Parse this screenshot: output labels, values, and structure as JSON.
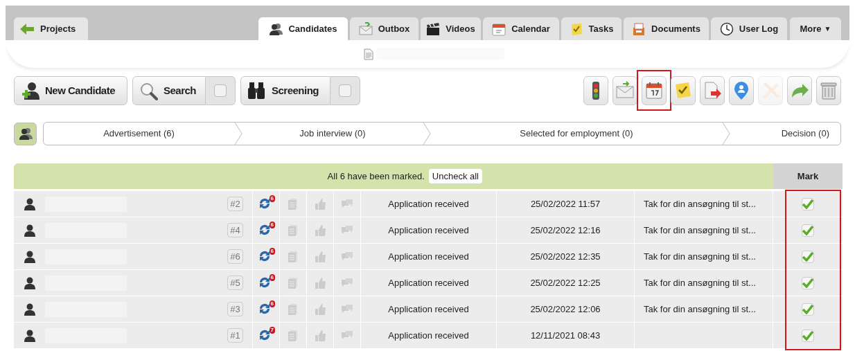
{
  "nav": {
    "back": "Projects",
    "tabs": [
      {
        "label": "Candidates",
        "selected": true
      },
      {
        "label": "Outbox",
        "selected": false
      },
      {
        "label": "Videos",
        "selected": false
      },
      {
        "label": "Calendar",
        "selected": false
      },
      {
        "label": "Tasks",
        "selected": false
      },
      {
        "label": "Documents",
        "selected": false
      },
      {
        "label": "User Log",
        "selected": false
      }
    ],
    "more": "More",
    "more_caret": "▼"
  },
  "toolbar": {
    "buttons": [
      {
        "kind": "plain",
        "label": "New Candidate"
      },
      {
        "kind": "toggle",
        "label": "Search",
        "checked": false
      },
      {
        "kind": "toggle",
        "label": "Screening",
        "checked": false
      }
    ],
    "actions": [
      {
        "highlighted": false,
        "disabled": false
      },
      {
        "highlighted": false,
        "disabled": false
      },
      {
        "highlighted": true,
        "disabled": false
      },
      {
        "highlighted": false,
        "disabled": false
      },
      {
        "highlighted": false,
        "disabled": false
      },
      {
        "highlighted": false,
        "disabled": false
      },
      {
        "highlighted": false,
        "disabled": true
      },
      {
        "highlighted": false,
        "disabled": false
      },
      {
        "highlighted": false,
        "disabled": false
      }
    ]
  },
  "pipeline": {
    "stages": [
      "Advertisement (6)",
      "Job interview (0)",
      "Selected for employment (0)",
      "Decision (0)"
    ]
  },
  "table": {
    "banner": "All 6 have been marked.",
    "uncheck_all": "Uncheck all",
    "mark_header": "Mark",
    "mark_highlighted": true,
    "rows": [
      {
        "number": "#2",
        "badge": "6",
        "status": "Application received",
        "date": "25/02/2022 11:57",
        "message": "Tak for din ansøgning til st...",
        "checked": true
      },
      {
        "number": "#4",
        "badge": "6",
        "status": "Application received",
        "date": "25/02/2022 12:16",
        "message": "Tak for din ansøgning til st...",
        "checked": true
      },
      {
        "number": "#6",
        "badge": "6",
        "status": "Application received",
        "date": "25/02/2022 12:35",
        "message": "Tak for din ansøgning til st...",
        "checked": true
      },
      {
        "number": "#5",
        "badge": "6",
        "status": "Application received",
        "date": "25/02/2022 12:25",
        "message": "Tak for din ansøgning til st...",
        "checked": true
      },
      {
        "number": "#3",
        "badge": "6",
        "status": "Application received",
        "date": "25/02/2022 12:06",
        "message": "Tak for din ansøgning til st...",
        "checked": true
      },
      {
        "number": "#1",
        "badge": "7",
        "status": "Application received",
        "date": "12/11/2021 08:43",
        "checked": true
      }
    ]
  }
}
